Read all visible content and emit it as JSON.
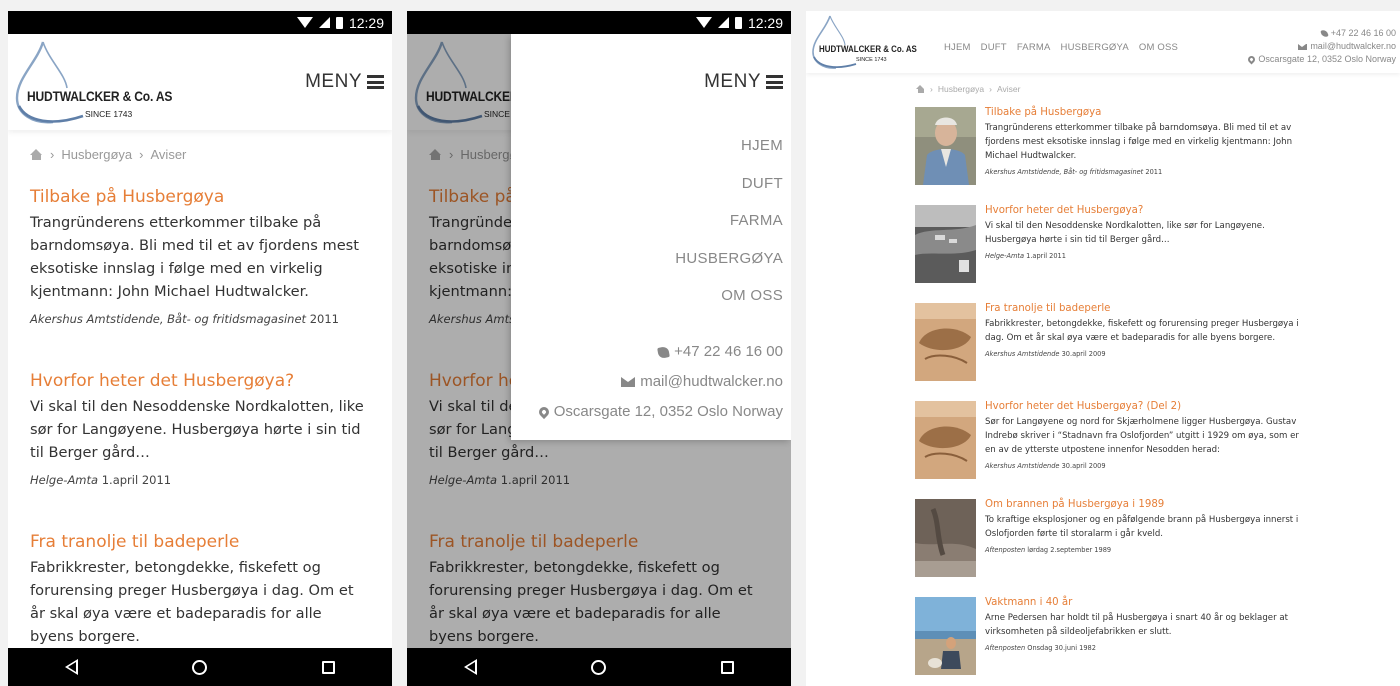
{
  "status_bar": {
    "time": "12:29"
  },
  "brand": {
    "name": "HUDTWALCKER & Co. AS",
    "since": "SINCE 1743"
  },
  "menu_label": "MENY",
  "breadcrumb": [
    "Husbergøya",
    "Aviser"
  ],
  "menu": {
    "items": [
      "HJEM",
      "DUFT",
      "FARMA",
      "HUSBERGØYA",
      "OM OSS"
    ]
  },
  "contact": {
    "phone": "+47 22 46 16 00",
    "email": "mail@hudtwalcker.no",
    "address": "Oscarsgate 12, 0352 Oslo Norway"
  },
  "articles": [
    {
      "title": "Tilbake på Husbergøya",
      "summary": "Trangründerens etterkommer tilbake på barndomsøya. Bli med til et av fjordens mest eksotiske innslag i følge med en virkelig kjentmann: John Michael Hudtwalcker.",
      "source": "Akershus Amtstidende, Båt- og fritidsmagasinet",
      "date": "2011"
    },
    {
      "title": "Hvorfor heter det Husbergøya?",
      "summary": "Vi skal til den Nesoddenske Nordkalotten, like sør for Langøyene. Husbergøya hørte i sin tid til Berger gård…",
      "source": "Helge-Amta",
      "date": "1.april 2011"
    },
    {
      "title": "Fra tranolje til badeperle",
      "summary": "Fabrikkrester, betongdekke, fiskefett og forurensing preger Husbergøya i dag. Om et år skal øya være et badeparadis for alle byens borgere.",
      "source": "Akershus Amtstidende",
      "date": "30.april 2009"
    },
    {
      "title": "Hvorfor heter det Husbergøya? (Del 2)",
      "summary": "Sør for Langøyene og nord for Skjærholmene ligger Husbergøya. Gustav Indrebø skriver i “Stadnavn fra Oslofjorden” utgitt i 1929 om øya, som er en av de ytterste utpostene innenfor Nesodden herad:",
      "source": "Akershus Amtstidende",
      "date": "30.april 2009"
    },
    {
      "title": "Om brannen på Husbergøya i 1989",
      "summary": "To kraftige eksplosjoner og en påfølgende brann på Husbergøya innerst i Oslofjorden førte til storalarm i går kveld.",
      "source": "Aftenposten",
      "date": "lørdag 2.september 1989"
    },
    {
      "title": "Vaktmann i 40 år",
      "summary": "Arne Pedersen har holdt til på Husbergøya i snart 40 år og beklager at virksomheten på sildeoljefabrikken er slutt.",
      "source": "Aftenposten",
      "date": "Onsdag 30.juni 1982"
    }
  ],
  "colors": {
    "accent": "#e67e37",
    "text": "#333333",
    "muted": "#888888"
  }
}
